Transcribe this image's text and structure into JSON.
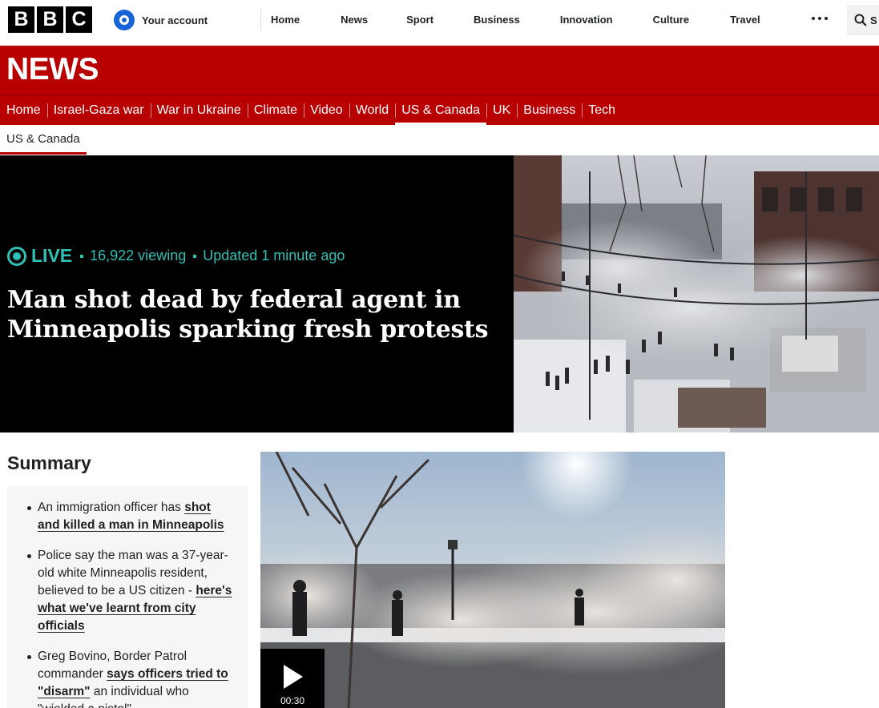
{
  "brand": {
    "letters": [
      "B",
      "B",
      "C"
    ]
  },
  "account": {
    "label": "Your account"
  },
  "top_nav": [
    "Home",
    "News",
    "Sport",
    "Business",
    "Innovation",
    "Culture",
    "Travel"
  ],
  "search": {
    "label": "S"
  },
  "news_banner": {
    "title": "NEWS"
  },
  "news_nav": {
    "items": [
      "Home",
      "Israel-Gaza war",
      "War in Ukraine",
      "Climate",
      "Video",
      "World",
      "US & Canada",
      "UK",
      "Business",
      "Tech"
    ],
    "active": "US & Canada"
  },
  "sub_nav": {
    "label": "US & Canada"
  },
  "hero": {
    "live_label": "LIVE",
    "viewing": "16,922 viewing",
    "updated": "Updated 1 minute ago",
    "headline": "Man shot dead by federal agent in Minneapolis sparking fresh protests"
  },
  "summary": {
    "heading": "Summary",
    "items": [
      {
        "text": "An immigration officer has ",
        "link": "shot and killed a man in Minneapolis",
        "after": ""
      },
      {
        "text": "Police say the man was a 37-year-old white Minneapolis resident, believed to be a US citizen - ",
        "link": "here's what we've learnt from city officials",
        "after": ""
      },
      {
        "text": "Greg Bovino, Border Patrol commander ",
        "link": "says officers tried to \"disarm\"",
        "after": " an individual who \"wielded a pistol\""
      }
    ]
  },
  "video": {
    "duration": "00:30"
  },
  "colors": {
    "bbc_red": "#b80000",
    "live_teal": "#2ebfb5",
    "black": "#000000"
  }
}
